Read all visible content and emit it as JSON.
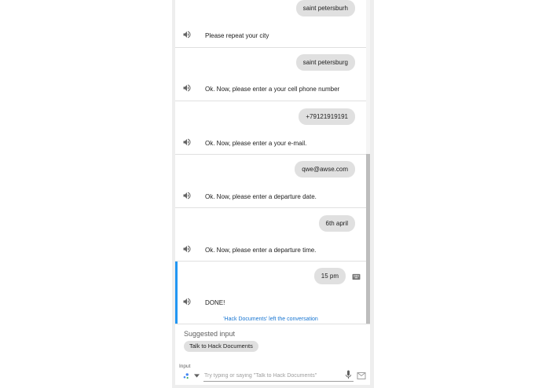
{
  "conversation": {
    "turns": [
      {
        "user": "saint petersburh",
        "reply": "Please repeat your city"
      },
      {
        "user": "saint petersburg",
        "reply": "Ok. Now, please enter a your cell phone number"
      },
      {
        "user": "+79121919191",
        "reply": "Ok. Now, please enter a your e-mail."
      },
      {
        "user": "qwe@awse.com",
        "reply": "Ok. Now, please enter a departure date."
      },
      {
        "user": "6th april",
        "reply": "Ok. Now, please enter a departure time."
      },
      {
        "user": "15 pm",
        "reply": "DONE!"
      }
    ],
    "left_note": "'Hack Documents' left the conversation"
  },
  "suggestions": {
    "title": "Suggested input",
    "chips": [
      "Talk to Hack Documents"
    ]
  },
  "input": {
    "label": "Input",
    "placeholder": "Try typing or saying \"Talk to Hack Documents\""
  },
  "icons": {
    "speaker": "speaker-icon",
    "keyboard": "keyboard-icon",
    "input_mode": "voice-mode-icon",
    "dropdown": "chevron-down-icon",
    "mic": "microphone-icon",
    "send": "send-icon"
  },
  "colors": {
    "accent": "#2196f3",
    "bubble": "#e0e0e0",
    "link": "#1976d2"
  }
}
